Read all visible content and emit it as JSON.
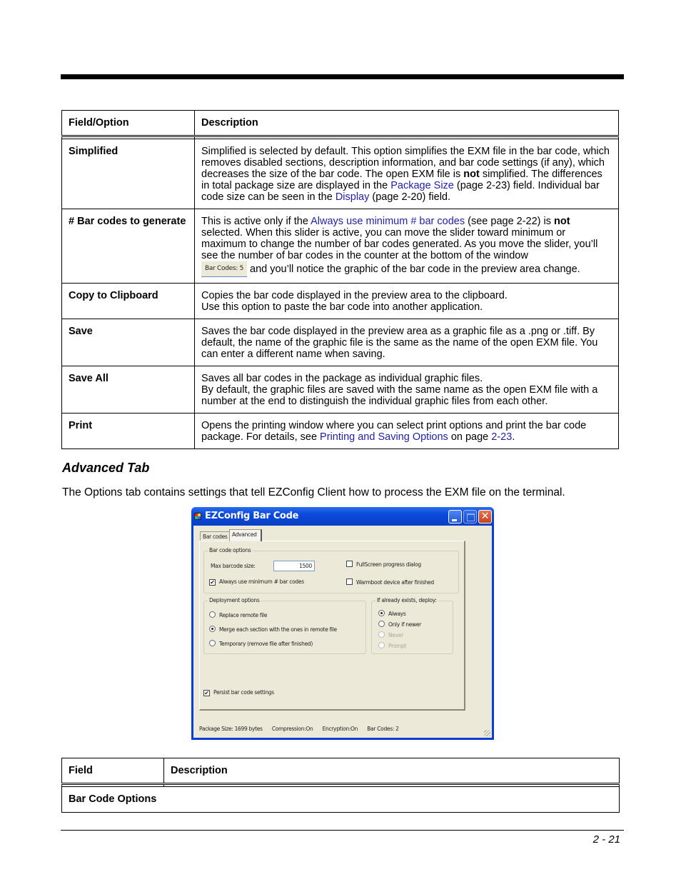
{
  "table1": {
    "headers": [
      "Field/Option",
      "Description"
    ],
    "rows": [
      {
        "field": "Simplified",
        "desc": {
          "p1": "Simplified is selected by default. This option simplifies the EXM file in the bar code, which removes disabled sections, description information, and bar code settings (if any), which decreases the size of the bar code. The open EXM file is ",
          "bold": "not",
          "p2": " simplified. The differences in total package size are displayed in the ",
          "link1": "Package Size",
          "p3": " (page 2-23) field. Individual bar code size can be seen in the ",
          "link2": "Display",
          "p4": " (page 2-20) field."
        }
      },
      {
        "field": "# Bar codes to generate",
        "desc": {
          "p1": "This is active only if the ",
          "link1": "Always use minimum # bar codes",
          "p2": " (see page 2-22) is ",
          "bold": "not",
          "p3": " selected. When this slider is active, you can move the slider toward minimum or maximum to change the number of bar codes generated. As you move the slider, you’ll see the number of bar codes in the counter at the bottom of the window",
          "inline_image_text": "Bar Codes: 5",
          "p4": "and you’ll notice the graphic of the bar code in the preview area change."
        }
      },
      {
        "field": "Copy to Clipboard",
        "desc": {
          "line1": "Copies the bar code displayed in the preview area to the clipboard.",
          "line2": "Use this option to paste the bar code into another application."
        }
      },
      {
        "field": "Save",
        "desc": {
          "text": "Saves the bar code displayed in the preview area as a graphic file as a .png or .tiff. By default, the name of the graphic file is the same as the name of the open EXM file. You can enter a different name when saving."
        }
      },
      {
        "field": "Save All",
        "desc": {
          "line1": "Saves all bar codes in the package as individual graphic files.",
          "line2": "By default, the graphic files are saved with the same name as the open EXM file with a number at the end to distinguish the individual graphic files from each other."
        }
      },
      {
        "field": "Print",
        "desc": {
          "p1": "Opens the printing window where you can select print options and print the bar code package. For details, see ",
          "link1": "Printing and Saving Options",
          "p2": " on page ",
          "link2": "2-23",
          "p3": "."
        }
      }
    ]
  },
  "section": {
    "title": "Advanced Tab",
    "intro": "The Options tab contains settings that tell EZConfig Client how to process the EXM file on the terminal."
  },
  "dialog": {
    "title": "EZConfig Bar Code",
    "tabs": [
      "Bar codes",
      "Advanced"
    ],
    "active_tab": "Advanced",
    "bar_code_options": {
      "label": "Bar code options",
      "max_size_label": "Max barcode size:",
      "max_size_value": "1500",
      "always_min_label": "Always use minimum # bar codes",
      "always_min_checked": true,
      "fullscreen_label": "FullScreen progress dialog",
      "fullscreen_checked": false,
      "warmboot_label": "Warmboot device after finished",
      "warmboot_checked": false
    },
    "deployment_options": {
      "label": "Deployment options",
      "options": [
        "Replace remote file",
        "Merge each section with the ones in remote file",
        "Temporary (remove file after finished)"
      ],
      "selected": "Merge each section with the ones in remote file"
    },
    "if_exists": {
      "label": "If already exists, deploy:",
      "options": [
        "Always",
        "Only if newer",
        "Never",
        "Prompt"
      ],
      "disabled": [
        "Never",
        "Prompt"
      ],
      "selected": "Always"
    },
    "persist_label": "Persist bar code settings",
    "persist_checked": true,
    "status": {
      "package_size": "Package Size: 1699 bytes",
      "compression": "Compression:On",
      "encryption": "Encryption:On",
      "bar_codes": "Bar Codes: 2"
    },
    "colors": {
      "titlebar": "#0a49d8",
      "face": "#ece9d8",
      "close": "#c9401c"
    }
  },
  "table2": {
    "headers": [
      "Field",
      "Description"
    ],
    "section_row": "Bar Code Options"
  },
  "footer": {
    "page_number": "2 - 21"
  }
}
